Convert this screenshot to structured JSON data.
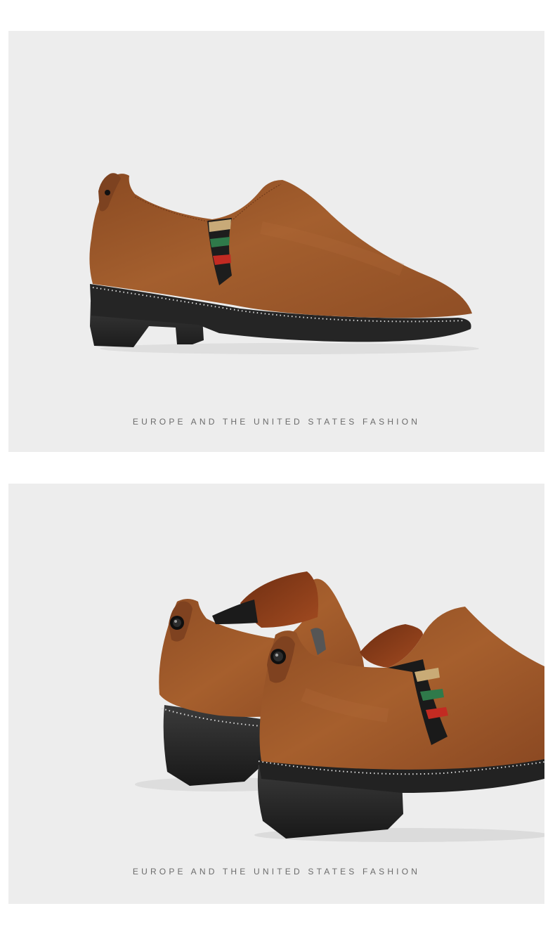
{
  "panels": [
    {
      "caption": "EUROPE AND THE UNITED STATES FASHION",
      "image": "side-view-suede-slip-on-shoe"
    },
    {
      "caption": "EUROPE AND THE UNITED STATES FASHION",
      "image": "rear-view-pair-of-suede-shoes"
    }
  ],
  "colors": {
    "panel_background": "#ededed",
    "suede": "#9a5428",
    "sole": "#2b2b2b",
    "caption_text": "#6b6b6b"
  }
}
